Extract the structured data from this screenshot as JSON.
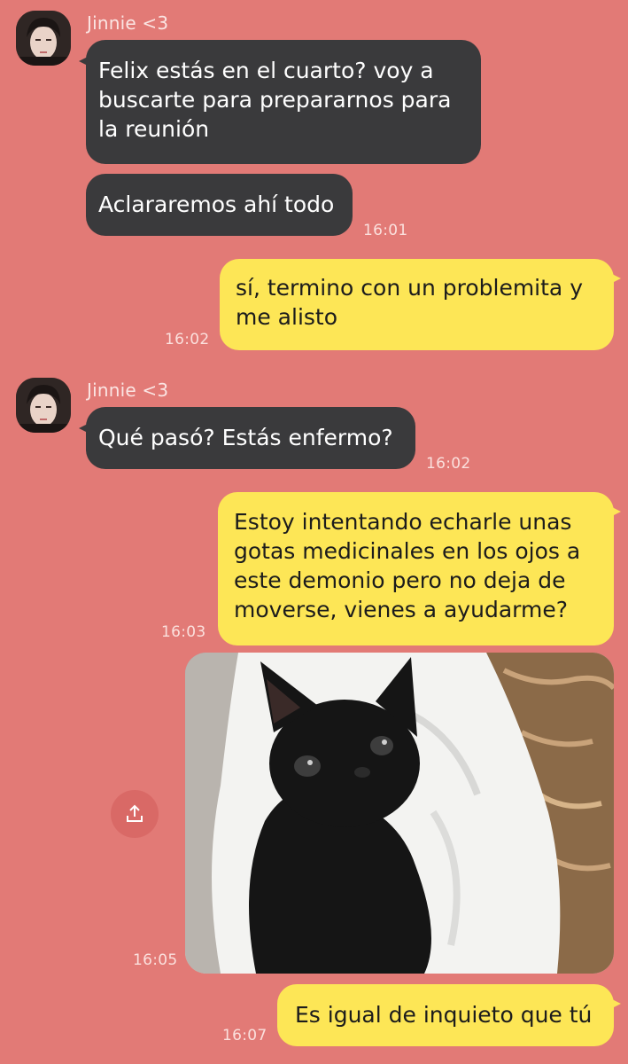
{
  "chat": {
    "contact_name": "Jinnie <3",
    "messages": [
      {
        "text": "Felix estás en el cuarto? voy a buscarte para prepararnos para la reunión"
      },
      {
        "text": "Aclararemos ahí todo",
        "time": "16:01"
      },
      {
        "text": "sí, termino con un problemita y me alisto",
        "time": "16:02"
      },
      {
        "text": "Qué pasó? Estás enfermo?",
        "time": "16:02"
      },
      {
        "text": "Estoy intentando echarle unas gotas medicinales en los ojos a este demonio pero no deja de moverse, vienes a ayudarme?",
        "time": "16:03"
      },
      {
        "photo_time": "16:05"
      },
      {
        "text": "Es igual de inquieto que tú",
        "time": "16:07"
      }
    ]
  },
  "icons": {
    "share": "share-icon",
    "avatar": "avatar-image",
    "photo": "black-kitten-photo"
  },
  "colors": {
    "background": "#e27a76",
    "incoming_bubble": "#3a3a3c",
    "outgoing_bubble": "#fde656"
  }
}
